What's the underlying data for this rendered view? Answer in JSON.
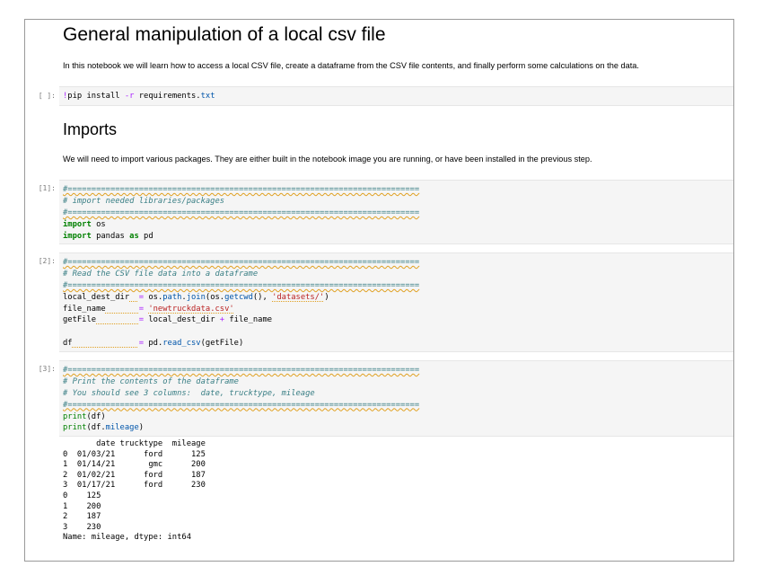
{
  "notebook": {
    "title": "General manipulation of a local csv file",
    "intro": "In this notebook we will learn how to access a local CSV file, create a dataframe from the CSV file contents, and finally perform some calculations on the data.",
    "imports_heading": "Imports",
    "imports_text": "We will need to import various packages. They are either built in the notebook image you are running, or have been installed in the previous step.",
    "cells": [
      {
        "prompt": "[ ]:",
        "lines": [
          "!pip install -r requirements.txt"
        ]
      },
      {
        "prompt": "[1]:",
        "lines": [
          "#==========================================================================",
          "# import needed libraries/packages",
          "#==========================================================================",
          "import os",
          "import pandas as pd"
        ]
      },
      {
        "prompt": "[2]:",
        "lines": [
          "#==========================================================================",
          "# Read the CSV file data into a dataframe",
          "#==========================================================================",
          "local_dest_dir  = os.path.join(os.getcwd(), 'datasets/')",
          "file_name       = 'newtruckdata.csv'",
          "getFile         = local_dest_dir + file_name",
          "",
          "df              = pd.read_csv(getFile)"
        ]
      },
      {
        "prompt": "[3]:",
        "lines": [
          "#==========================================================================",
          "# Print the contents of the dataframe",
          "# You should see 3 columns:  date, trucktype, mileage",
          "#==========================================================================",
          "print(df)",
          "print(df.mileage)"
        ]
      }
    ],
    "output_lines": [
      "       date trucktype  mileage",
      "0  01/03/21      ford      125",
      "1  01/14/21       gmc      200",
      "2  01/02/21      ford      187",
      "3  01/17/21      ford      230",
      "0    125",
      "1    200",
      "2    187",
      "3    230",
      "Name: mileage, dtype: int64"
    ]
  }
}
